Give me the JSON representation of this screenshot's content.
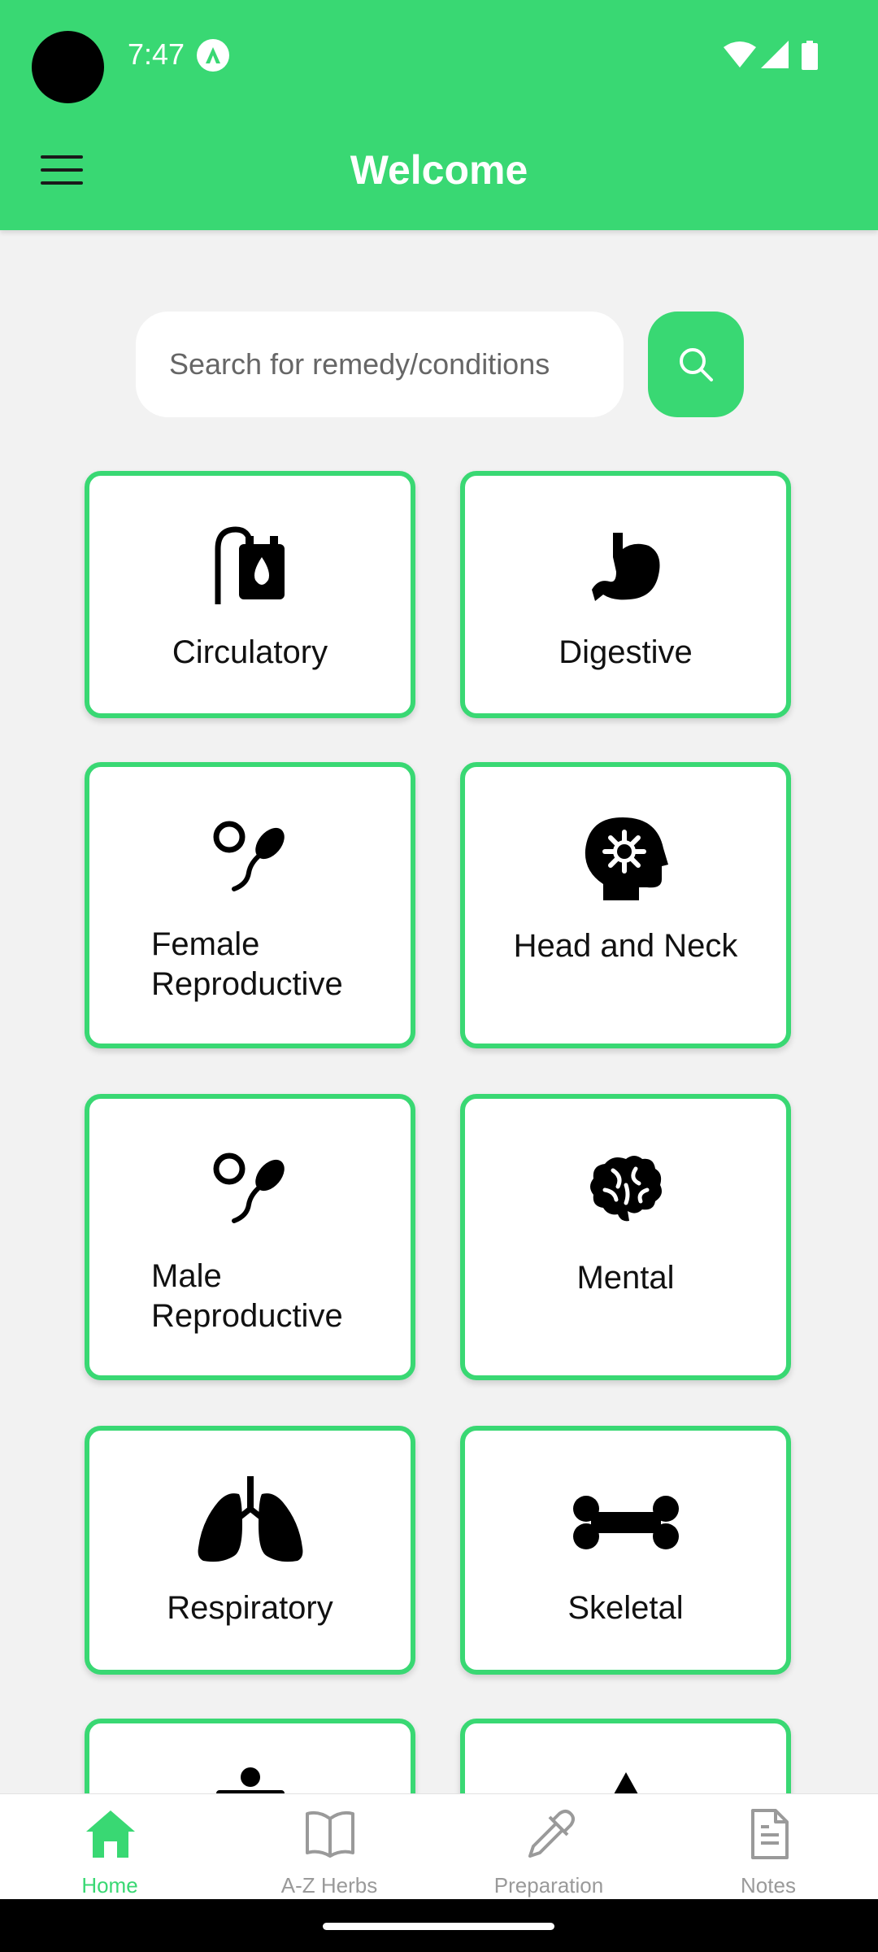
{
  "status_bar": {
    "time": "7:47"
  },
  "header": {
    "title": "Welcome"
  },
  "search": {
    "placeholder": "Search for remedy/conditions"
  },
  "categories": [
    {
      "label": "Circulatory",
      "icon": "heart-battery-icon"
    },
    {
      "label": "Digestive",
      "icon": "stomach-icon"
    },
    {
      "label_line1": "Female",
      "label_line2": "Reproductive",
      "icon": "sperm-egg-icon"
    },
    {
      "label": "Head and Neck",
      "icon": "head-virus-icon"
    },
    {
      "label_line1": "Male",
      "label_line2": "Reproductive",
      "icon": "sperm-egg-icon"
    },
    {
      "label": "Mental",
      "icon": "brain-icon"
    },
    {
      "label": "Respiratory",
      "icon": "lungs-icon"
    },
    {
      "label": "Skeletal",
      "icon": "bone-icon"
    }
  ],
  "bottom_nav": [
    {
      "label": "Home",
      "icon": "home-icon",
      "active": true
    },
    {
      "label": "A-Z Herbs",
      "icon": "book-icon",
      "active": false
    },
    {
      "label": "Preparation",
      "icon": "dropper-icon",
      "active": false
    },
    {
      "label": "Notes",
      "icon": "document-icon",
      "active": false
    }
  ],
  "colors": {
    "accent": "#39d873",
    "background": "#f2f2f2"
  }
}
